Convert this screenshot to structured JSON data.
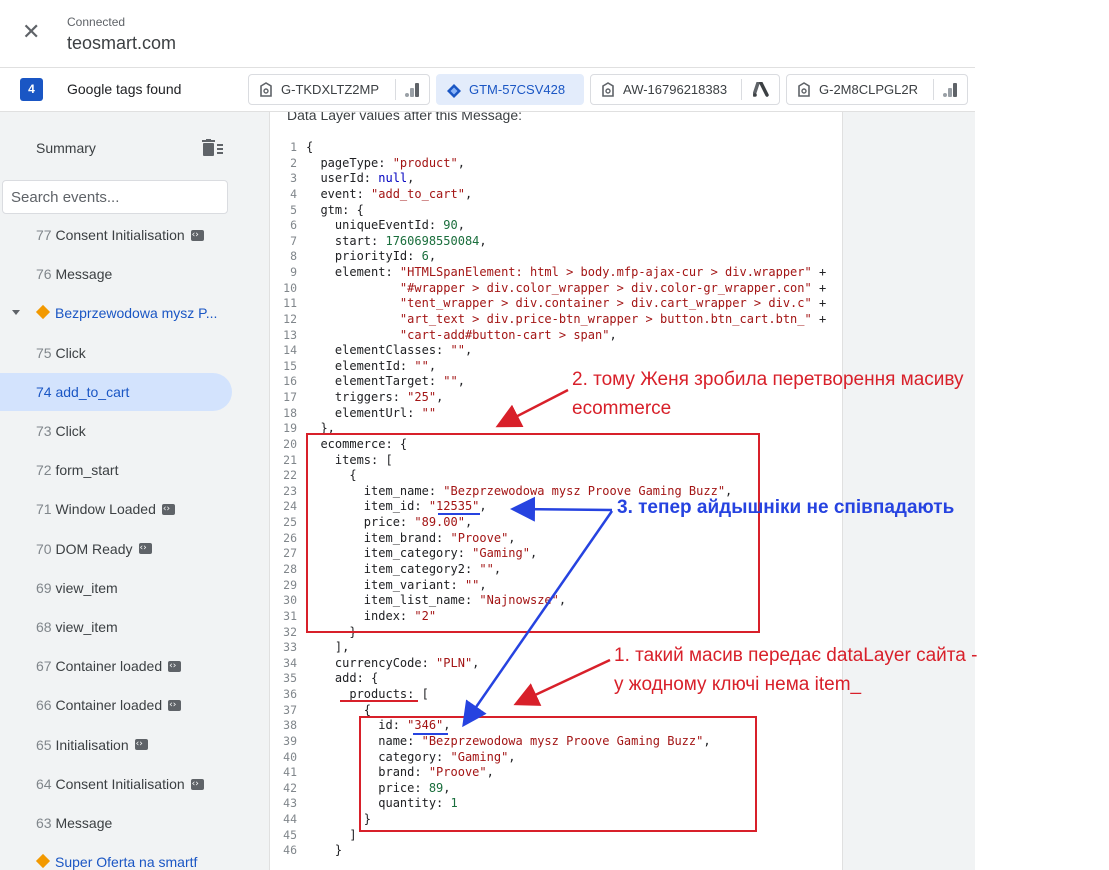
{
  "header": {
    "status": "Connected",
    "domain": "teosmart.com",
    "close_icon": "close-icon"
  },
  "tags_bar": {
    "count": "4",
    "label": "Google tags found",
    "tags": [
      {
        "id": "G-TKDXLTZ2MP",
        "active": false
      },
      {
        "id": "GTM-57CSV428",
        "active": true
      },
      {
        "id": "AW-16796218383",
        "active": false
      },
      {
        "id": "G-2M8CLPGL2R",
        "active": false
      }
    ]
  },
  "sidebar": {
    "summary": "Summary",
    "search_placeholder": "Search events...",
    "events": [
      {
        "num": "77",
        "label": "Consent Initialisation",
        "code": true
      },
      {
        "num": "76",
        "label": "Message",
        "code": false
      },
      {
        "num": "",
        "label": "Bezprzewodowa mysz P...",
        "code": false,
        "page": true
      },
      {
        "num": "75",
        "label": "Click",
        "code": false
      },
      {
        "num": "74",
        "label": "add_to_cart",
        "code": false,
        "selected": true
      },
      {
        "num": "73",
        "label": "Click",
        "code": false
      },
      {
        "num": "72",
        "label": "form_start",
        "code": false
      },
      {
        "num": "71",
        "label": "Window Loaded",
        "code": true
      },
      {
        "num": "70",
        "label": "DOM Ready",
        "code": true
      },
      {
        "num": "69",
        "label": "view_item",
        "code": false
      },
      {
        "num": "68",
        "label": "view_item",
        "code": false
      },
      {
        "num": "67",
        "label": "Container loaded",
        "code": true
      },
      {
        "num": "66",
        "label": "Container loaded",
        "code": true
      },
      {
        "num": "65",
        "label": "Initialisation",
        "code": true
      },
      {
        "num": "64",
        "label": "Consent Initialisation",
        "code": true
      },
      {
        "num": "63",
        "label": "Message",
        "code": false
      },
      {
        "num": "",
        "label": "Super Oferta na smartf",
        "code": false,
        "page": true
      }
    ]
  },
  "main": {
    "title": "Data Layer values after this Message:",
    "code_lines": [
      "{",
      "  pageType: \"product\",",
      "  userId: null,",
      "  event: \"add_to_cart\",",
      "  gtm: {",
      "    uniqueEventId: 90,",
      "    start: 1760698550084,",
      "    priorityId: 6,",
      "    element: \"HTMLSpanElement: html > body.mfp-ajax-cur > div.wrapper\" +",
      "             \"#wrapper > div.color_wrapper > div.color-gr_wrapper.con\" +",
      "             \"tent_wrapper > div.container > div.cart_wrapper > div.c\" +",
      "             \"art_text > div.price-btn_wrapper > button.btn_cart.btn_\" +",
      "             \"cart-add#button-cart > span\",",
      "    elementClasses: \"\",",
      "    elementId: \"\",",
      "    elementTarget: \"\",",
      "    triggers: \"25\",",
      "    elementUrl: \"\"",
      "  },",
      "  ecommerce: {",
      "    items: [",
      "      {",
      "        item_name: \"Bezprzewodowa mysz Proove Gaming Buzz\",",
      "        item_id: \"12535\",",
      "        price: \"89.00\",",
      "        item_brand: \"Proove\",",
      "        item_category: \"Gaming\",",
      "        item_category2: \"\",",
      "        item_variant: \"\",",
      "        item_list_name: \"Najnowsze\",",
      "        index: \"2\"",
      "      }",
      "    ],",
      "    currencyCode: \"PLN\",",
      "    add: {",
      "      products: [",
      "        {",
      "          id: \"346\",",
      "          name: \"Bezprzewodowa mysz Proove Gaming Buzz\",",
      "          category: \"Gaming\",",
      "          brand: \"Proove\",",
      "          price: 89,",
      "          quantity: 1",
      "        }",
      "      ]",
      "    }"
    ]
  },
  "annotations": {
    "note2_line1": "2.  тому Женя зробила перетворення масиву",
    "note2_line2": "ecommerce",
    "note3": "3. тепер айдышніки не співпадають",
    "note1_line1": "1. такий масив передає dataLayer сайта -",
    "note1_line2": "у жодному ключі нема item_"
  },
  "colors": {
    "accent": "#1a56c4",
    "annotation_red": "#d8202a",
    "annotation_blue": "#2643e0"
  }
}
